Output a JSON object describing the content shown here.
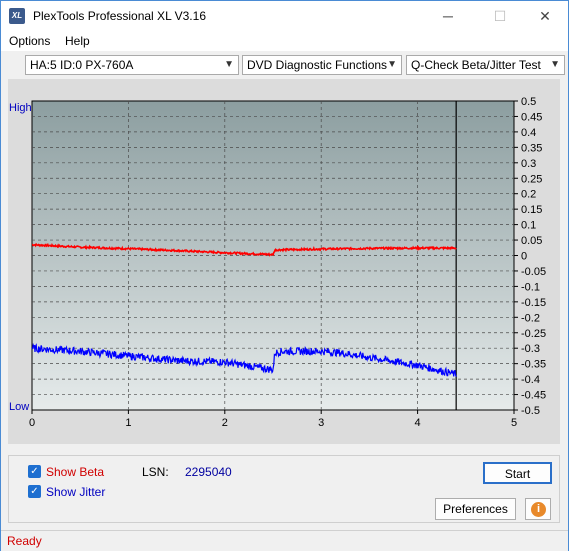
{
  "window": {
    "title": "PlexTools Professional XL V3.16",
    "icon_text": "XL"
  },
  "controls": {
    "minimize": "─",
    "maximize": "☐",
    "close": "✕"
  },
  "menu": {
    "options": "Options",
    "help": "Help"
  },
  "selectors": {
    "drive": "HA:5 ID:0  PX-760A",
    "function": "DVD Diagnostic Functions",
    "test": "Q-Check Beta/Jitter Test"
  },
  "chart": {
    "high_label": "High",
    "low_label": "Low",
    "y_ticks": [
      "0.5",
      "0.45",
      "0.4",
      "0.35",
      "0.3",
      "0.25",
      "0.2",
      "0.15",
      "0.1",
      "0.05",
      "0",
      "-0.05",
      "-0.1",
      "-0.15",
      "-0.2",
      "-0.25",
      "-0.3",
      "-0.35",
      "-0.4",
      "-0.45",
      "-0.5"
    ],
    "x_ticks": [
      "0",
      "1",
      "2",
      "3",
      "4",
      "5"
    ],
    "colors": {
      "beta": "#ff0000",
      "jitter": "#0000ff",
      "plot_top": "#8c9ea0",
      "plot_bottom": "#e6ebeb"
    }
  },
  "chart_data": {
    "type": "line",
    "xlim": [
      0,
      5
    ],
    "ylim": [
      -0.5,
      0.5
    ],
    "grid": true,
    "end_marker_x": 4.4,
    "series": [
      {
        "name": "Beta",
        "x": [
          0,
          0.5,
          1.0,
          1.5,
          2.0,
          2.5,
          2.52,
          3.0,
          3.5,
          4.0,
          4.4
        ],
        "y": [
          0.035,
          0.027,
          0.022,
          0.016,
          0.009,
          0.003,
          0.018,
          0.021,
          0.023,
          0.024,
          0.024
        ]
      },
      {
        "name": "Jitter",
        "x": [
          0,
          0.5,
          1.0,
          1.5,
          2.0,
          2.5,
          2.52,
          2.6,
          2.8,
          3.0,
          3.2,
          3.5,
          3.8,
          4.0,
          4.2,
          4.4
        ],
        "y": [
          -0.3,
          -0.31,
          -0.325,
          -0.34,
          -0.345,
          -0.37,
          -0.315,
          -0.31,
          -0.31,
          -0.31,
          -0.315,
          -0.33,
          -0.345,
          -0.355,
          -0.37,
          -0.385
        ]
      }
    ]
  },
  "options_panel": {
    "show_beta": "Show Beta",
    "show_jitter": "Show Jitter",
    "lsn_label": "LSN:",
    "lsn_value": "2295040",
    "start": "Start",
    "preferences": "Preferences",
    "info_icon": "i"
  },
  "status": {
    "text": "Ready"
  }
}
